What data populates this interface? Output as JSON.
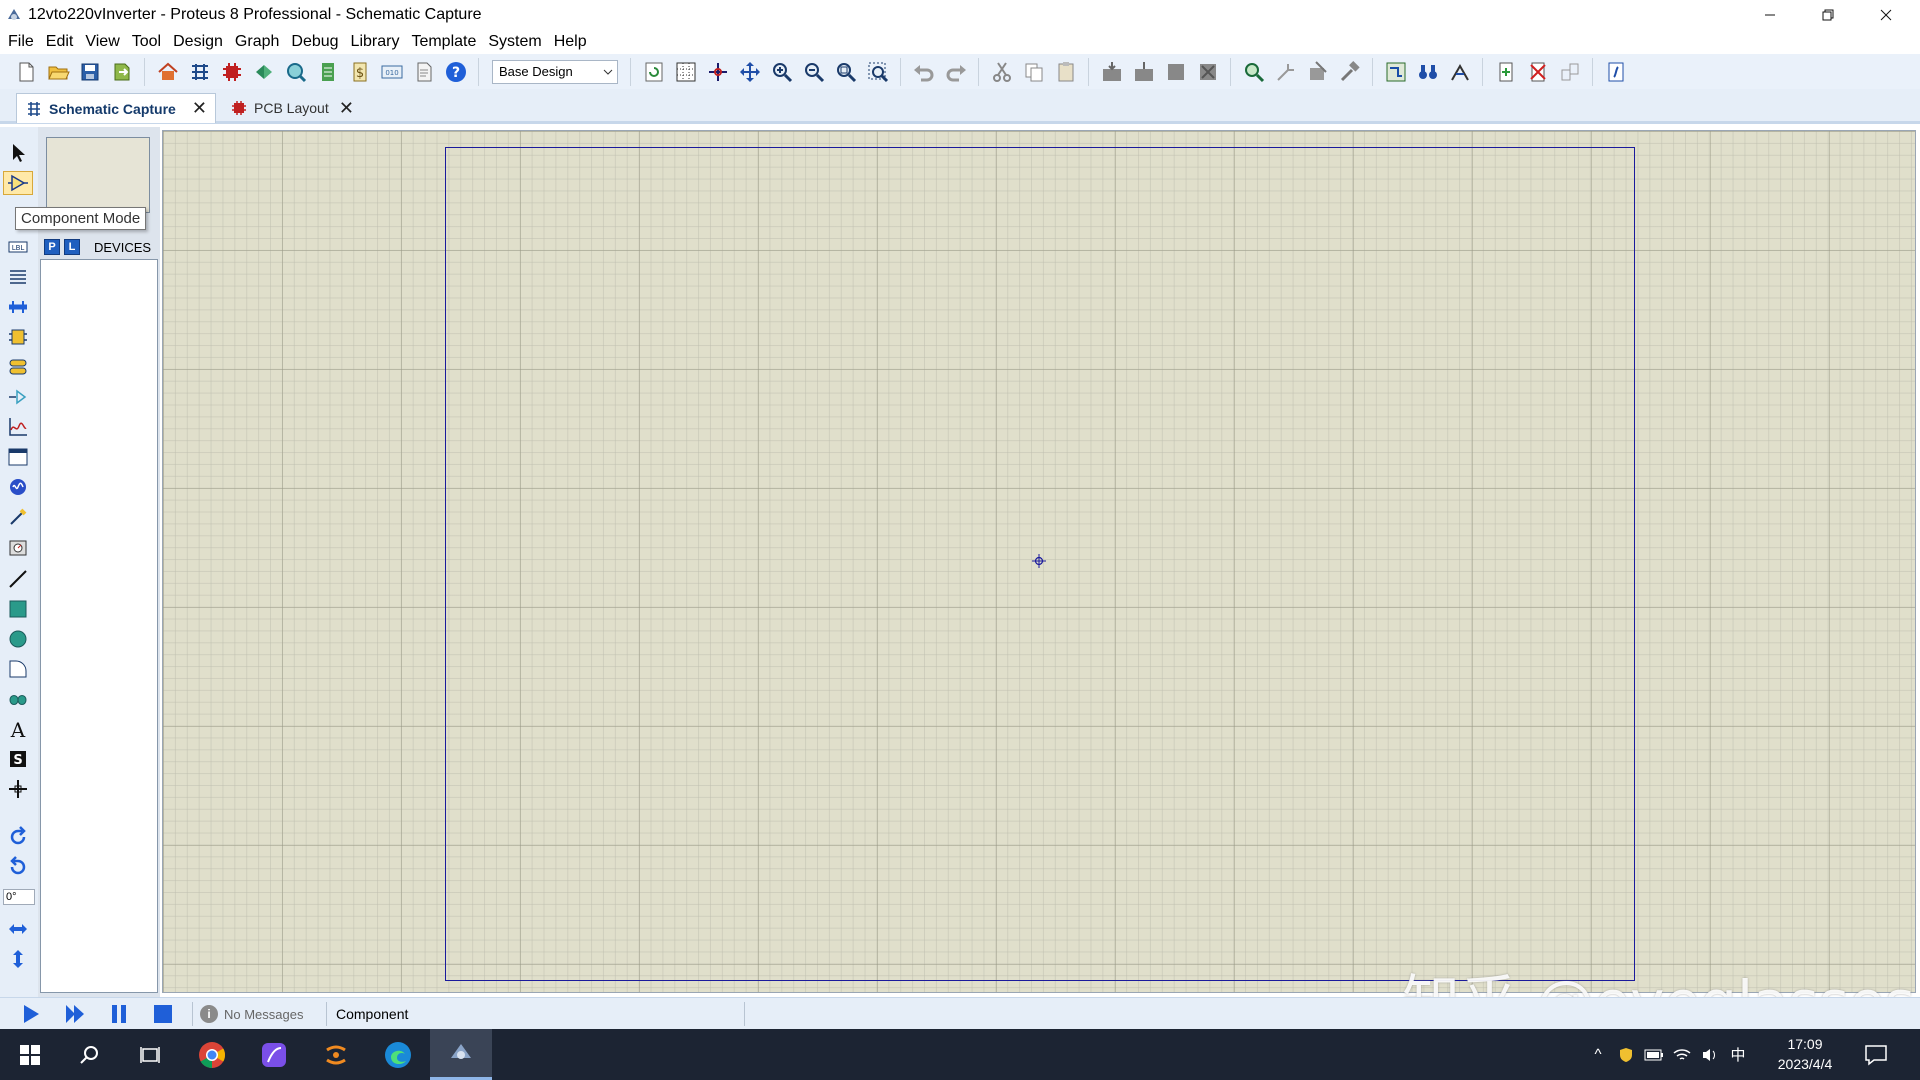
{
  "window": {
    "title": "12vto220vInverter - Proteus 8 Professional - Schematic Capture"
  },
  "menu": [
    "File",
    "Edit",
    "View",
    "Tool",
    "Design",
    "Graph",
    "Debug",
    "Library",
    "Template",
    "System",
    "Help"
  ],
  "toolbar": {
    "design_select": "Base Design"
  },
  "tabs": [
    {
      "label": "Schematic Capture"
    },
    {
      "label": "PCB Layout"
    }
  ],
  "tooltip": "Component Mode",
  "selector": {
    "p_label": "P",
    "l_label": "L",
    "title": "DEVICES"
  },
  "rotation": "0°",
  "status": {
    "messages": "No Messages",
    "mode": "Component"
  },
  "watermark": "知乎 @eyeglasses",
  "taskbar": {
    "ime": "中",
    "time": "17:09",
    "date": "2023/4/4"
  },
  "colors": {
    "sheet_border": "#1a1a9c",
    "canvas": "#e0dfcb",
    "accent": "#1f5fbf"
  }
}
